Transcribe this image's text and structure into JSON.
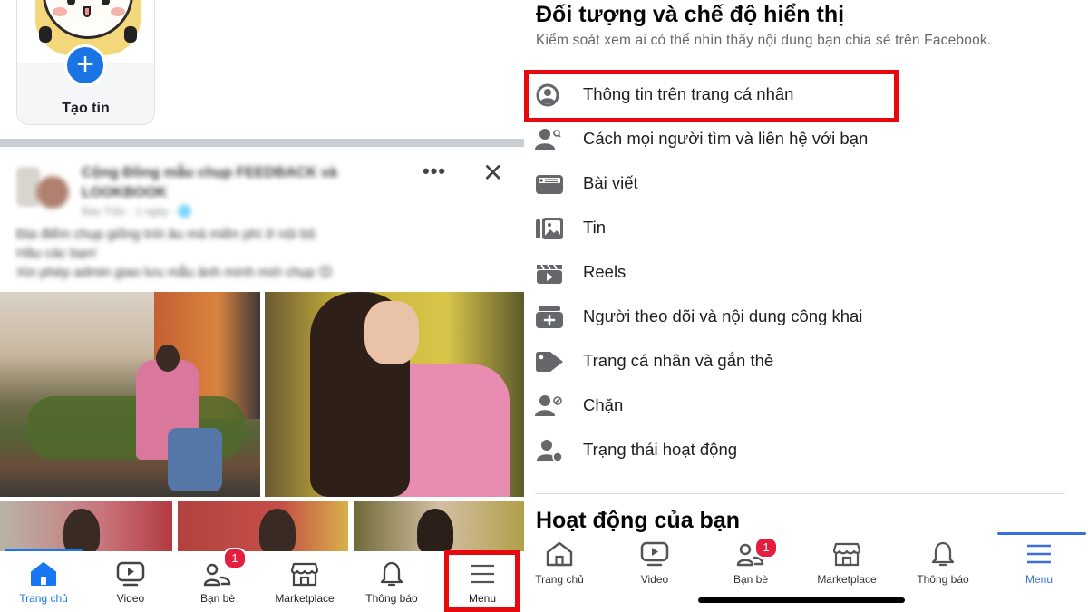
{
  "left_screen": {
    "story": {
      "create_label": "Tạo tin",
      "plus_symbol": "+"
    },
    "post": {
      "author": "Cộng Đồng mẫu chụp FEEDBACK và LOOKBOOK",
      "meta": "Bao Trần · 1 ngày · 🌐",
      "text_lines": [
        "Địa điểm chụp giống trời âu mà miền phí ở nội bộ",
        "Hầu các bạn!",
        "Xin phép admin giao lưu mẫu ảnh mình mới chụp 😊"
      ],
      "more_symbol": "•••",
      "close_symbol": "✕",
      "blurred": true
    },
    "bottom_nav": {
      "items": [
        {
          "label": "Trang chủ",
          "icon": "home-icon",
          "active": true
        },
        {
          "label": "Video",
          "icon": "video-icon",
          "active": false
        },
        {
          "label": "Bạn bè",
          "icon": "friends-icon",
          "active": false,
          "badge": "1"
        },
        {
          "label": "Marketplace",
          "icon": "marketplace-icon",
          "active": false
        },
        {
          "label": "Thông báo",
          "icon": "bell-icon",
          "active": false
        },
        {
          "label": "Menu",
          "icon": "menu-icon",
          "active": false,
          "highlighted": true
        }
      ]
    }
  },
  "right_screen": {
    "section_title": "Đối tượng và chế độ hiển thị",
    "section_description": "Kiểm soát xem ai có thể nhìn thấy nội dung bạn chia sẻ trên Facebook.",
    "settings": [
      {
        "label": "Thông tin trên trang cá nhân",
        "icon": "profile-circle-icon",
        "highlighted": true
      },
      {
        "label": "Cách mọi người tìm và liên hệ với bạn",
        "icon": "person-search-icon"
      },
      {
        "label": "Bài viết",
        "icon": "post-card-icon"
      },
      {
        "label": "Tin",
        "icon": "stories-icon"
      },
      {
        "label": "Reels",
        "icon": "reels-icon"
      },
      {
        "label": "Người theo dõi và nội dung công khai",
        "icon": "followers-icon"
      },
      {
        "label": "Trang cá nhân và gắn thẻ",
        "icon": "tag-icon"
      },
      {
        "label": "Chặn",
        "icon": "block-user-icon"
      },
      {
        "label": "Trạng thái hoạt động",
        "icon": "active-status-icon"
      }
    ],
    "next_section_title": "Hoạt động của bạn",
    "bottom_nav": {
      "items": [
        {
          "label": "Trang chủ",
          "icon": "home-icon",
          "active": false
        },
        {
          "label": "Video",
          "icon": "video-icon",
          "active": false
        },
        {
          "label": "Bạn bè",
          "icon": "friends-icon",
          "active": false,
          "badge": "1"
        },
        {
          "label": "Marketplace",
          "icon": "marketplace-icon",
          "active": false
        },
        {
          "label": "Thông báo",
          "icon": "bell-icon",
          "active": false
        },
        {
          "label": "Menu",
          "icon": "menu-icon",
          "active": true
        }
      ]
    }
  },
  "colors": {
    "facebook_blue": "#1877f2",
    "highlight_red": "#e8090f",
    "badge_red": "#e41e3f",
    "icon_gray": "#65676b"
  }
}
